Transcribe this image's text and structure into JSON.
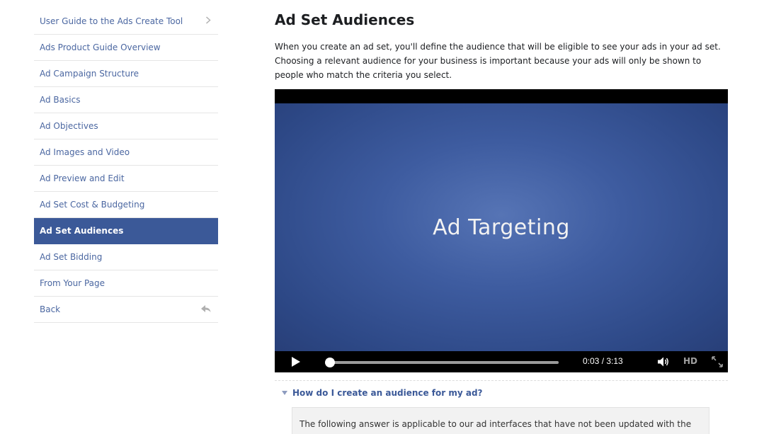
{
  "sidebar": {
    "items": [
      {
        "label": "User Guide to the Ads Create Tool",
        "icon": "chevron-right-icon"
      },
      {
        "label": "Ads Product Guide Overview"
      },
      {
        "label": "Ad Campaign Structure"
      },
      {
        "label": "Ad Basics"
      },
      {
        "label": "Ad Objectives"
      },
      {
        "label": "Ad Images and Video"
      },
      {
        "label": "Ad Preview and Edit"
      },
      {
        "label": "Ad Set Cost & Budgeting"
      },
      {
        "label": "Ad Set Audiences",
        "active": true
      },
      {
        "label": "Ad Set Bidding"
      },
      {
        "label": "From Your Page"
      },
      {
        "label": "Back",
        "icon": "back-arrow-icon"
      }
    ]
  },
  "main": {
    "title": "Ad Set Audiences",
    "intro": "When you create an ad set, you'll define the audience that will be eligible to see your ads in your ad set. Choosing a relevant audience for your business is important because your ads will only be shown to people who match the criteria you select."
  },
  "video": {
    "title_card": "Ad Targeting",
    "time": "0:03 / 3:13",
    "progress": 0.016,
    "hd_label": "HD",
    "icons": [
      "play-icon",
      "volume-icon",
      "fullscreen-icon"
    ]
  },
  "faq": {
    "question": "How do I create an audience for my ad?",
    "answer": "The following answer is applicable to our ad interfaces that have not been updated with the new ad"
  },
  "colors": {
    "accent": "#3b5998",
    "link": "#4b67a1",
    "video_bg": "#3e5ca0"
  }
}
